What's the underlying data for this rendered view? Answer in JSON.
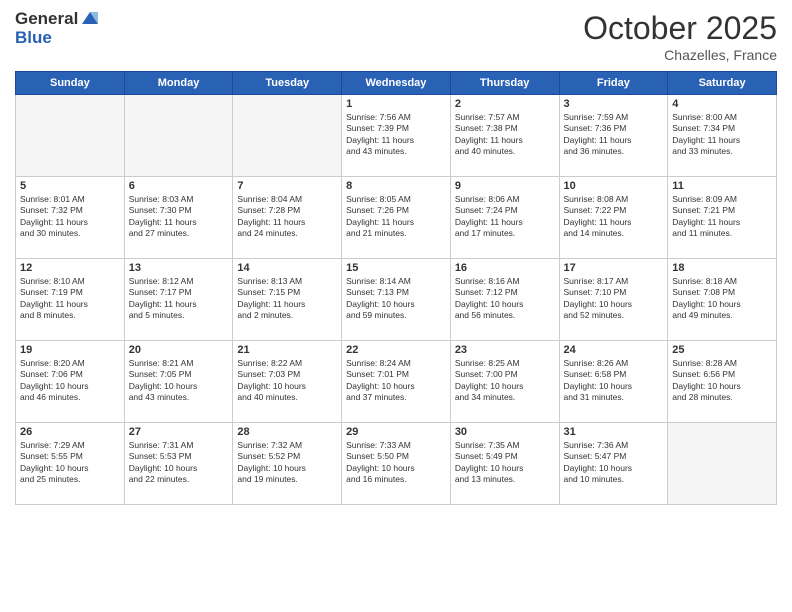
{
  "header": {
    "logo": {
      "line1": "General",
      "line2": "Blue"
    },
    "month": "October 2025",
    "location": "Chazelles, France"
  },
  "weekdays": [
    "Sunday",
    "Monday",
    "Tuesday",
    "Wednesday",
    "Thursday",
    "Friday",
    "Saturday"
  ],
  "weeks": [
    [
      {
        "day": "",
        "info": ""
      },
      {
        "day": "",
        "info": ""
      },
      {
        "day": "",
        "info": ""
      },
      {
        "day": "1",
        "info": "Sunrise: 7:56 AM\nSunset: 7:39 PM\nDaylight: 11 hours\nand 43 minutes."
      },
      {
        "day": "2",
        "info": "Sunrise: 7:57 AM\nSunset: 7:38 PM\nDaylight: 11 hours\nand 40 minutes."
      },
      {
        "day": "3",
        "info": "Sunrise: 7:59 AM\nSunset: 7:36 PM\nDaylight: 11 hours\nand 36 minutes."
      },
      {
        "day": "4",
        "info": "Sunrise: 8:00 AM\nSunset: 7:34 PM\nDaylight: 11 hours\nand 33 minutes."
      }
    ],
    [
      {
        "day": "5",
        "info": "Sunrise: 8:01 AM\nSunset: 7:32 PM\nDaylight: 11 hours\nand 30 minutes."
      },
      {
        "day": "6",
        "info": "Sunrise: 8:03 AM\nSunset: 7:30 PM\nDaylight: 11 hours\nand 27 minutes."
      },
      {
        "day": "7",
        "info": "Sunrise: 8:04 AM\nSunset: 7:28 PM\nDaylight: 11 hours\nand 24 minutes."
      },
      {
        "day": "8",
        "info": "Sunrise: 8:05 AM\nSunset: 7:26 PM\nDaylight: 11 hours\nand 21 minutes."
      },
      {
        "day": "9",
        "info": "Sunrise: 8:06 AM\nSunset: 7:24 PM\nDaylight: 11 hours\nand 17 minutes."
      },
      {
        "day": "10",
        "info": "Sunrise: 8:08 AM\nSunset: 7:22 PM\nDaylight: 11 hours\nand 14 minutes."
      },
      {
        "day": "11",
        "info": "Sunrise: 8:09 AM\nSunset: 7:21 PM\nDaylight: 11 hours\nand 11 minutes."
      }
    ],
    [
      {
        "day": "12",
        "info": "Sunrise: 8:10 AM\nSunset: 7:19 PM\nDaylight: 11 hours\nand 8 minutes."
      },
      {
        "day": "13",
        "info": "Sunrise: 8:12 AM\nSunset: 7:17 PM\nDaylight: 11 hours\nand 5 minutes."
      },
      {
        "day": "14",
        "info": "Sunrise: 8:13 AM\nSunset: 7:15 PM\nDaylight: 11 hours\nand 2 minutes."
      },
      {
        "day": "15",
        "info": "Sunrise: 8:14 AM\nSunset: 7:13 PM\nDaylight: 10 hours\nand 59 minutes."
      },
      {
        "day": "16",
        "info": "Sunrise: 8:16 AM\nSunset: 7:12 PM\nDaylight: 10 hours\nand 56 minutes."
      },
      {
        "day": "17",
        "info": "Sunrise: 8:17 AM\nSunset: 7:10 PM\nDaylight: 10 hours\nand 52 minutes."
      },
      {
        "day": "18",
        "info": "Sunrise: 8:18 AM\nSunset: 7:08 PM\nDaylight: 10 hours\nand 49 minutes."
      }
    ],
    [
      {
        "day": "19",
        "info": "Sunrise: 8:20 AM\nSunset: 7:06 PM\nDaylight: 10 hours\nand 46 minutes."
      },
      {
        "day": "20",
        "info": "Sunrise: 8:21 AM\nSunset: 7:05 PM\nDaylight: 10 hours\nand 43 minutes."
      },
      {
        "day": "21",
        "info": "Sunrise: 8:22 AM\nSunset: 7:03 PM\nDaylight: 10 hours\nand 40 minutes."
      },
      {
        "day": "22",
        "info": "Sunrise: 8:24 AM\nSunset: 7:01 PM\nDaylight: 10 hours\nand 37 minutes."
      },
      {
        "day": "23",
        "info": "Sunrise: 8:25 AM\nSunset: 7:00 PM\nDaylight: 10 hours\nand 34 minutes."
      },
      {
        "day": "24",
        "info": "Sunrise: 8:26 AM\nSunset: 6:58 PM\nDaylight: 10 hours\nand 31 minutes."
      },
      {
        "day": "25",
        "info": "Sunrise: 8:28 AM\nSunset: 6:56 PM\nDaylight: 10 hours\nand 28 minutes."
      }
    ],
    [
      {
        "day": "26",
        "info": "Sunrise: 7:29 AM\nSunset: 5:55 PM\nDaylight: 10 hours\nand 25 minutes."
      },
      {
        "day": "27",
        "info": "Sunrise: 7:31 AM\nSunset: 5:53 PM\nDaylight: 10 hours\nand 22 minutes."
      },
      {
        "day": "28",
        "info": "Sunrise: 7:32 AM\nSunset: 5:52 PM\nDaylight: 10 hours\nand 19 minutes."
      },
      {
        "day": "29",
        "info": "Sunrise: 7:33 AM\nSunset: 5:50 PM\nDaylight: 10 hours\nand 16 minutes."
      },
      {
        "day": "30",
        "info": "Sunrise: 7:35 AM\nSunset: 5:49 PM\nDaylight: 10 hours\nand 13 minutes."
      },
      {
        "day": "31",
        "info": "Sunrise: 7:36 AM\nSunset: 5:47 PM\nDaylight: 10 hours\nand 10 minutes."
      },
      {
        "day": "",
        "info": ""
      }
    ]
  ]
}
